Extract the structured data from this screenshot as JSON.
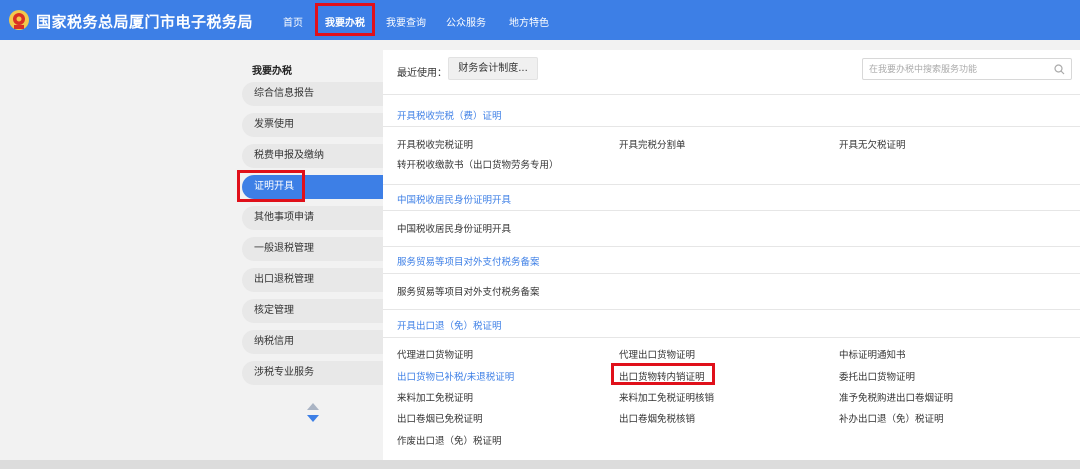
{
  "header": {
    "title": "国家税务总局厦门市电子税务局",
    "nav": [
      "首页",
      "我要办税",
      "我要查询",
      "公众服务",
      "地方特色"
    ],
    "active_nav": "我要办税"
  },
  "sidebar": {
    "title": "我要办税",
    "items": [
      "综合信息报告",
      "发票使用",
      "税费申报及缴纳",
      "证明开具",
      "其他事项申请",
      "一般退税管理",
      "出口退税管理",
      "核定管理",
      "纳税信用",
      "涉税专业服务"
    ],
    "active_item": "证明开具"
  },
  "toolbar": {
    "recent_label": "最近使用：",
    "recent_item": "财务会计制度...",
    "search_placeholder": "在我要办税中搜索服务功能"
  },
  "sections": [
    {
      "title": "开具税收完税（费）证明",
      "items": [
        "开具税收完税证明",
        "开具完税分割单",
        "开具无欠税证明",
        "转开税收缴款书（出口货物劳务专用）"
      ]
    },
    {
      "title": "中国税收居民身份证明开具",
      "items": [
        "中国税收居民身份证明开具"
      ]
    },
    {
      "title": "服务贸易等项目对外支付税务备案",
      "items": [
        "服务贸易等项目对外支付税务备案"
      ]
    },
    {
      "title": "开具出口退（免）税证明",
      "items": [
        "代理进口货物证明",
        "代理出口货物证明",
        "中标证明通知书",
        "出口货物已补税/未退税证明",
        "出口货物转内销证明",
        "委托出口货物证明",
        "来料加工免税证明",
        "来料加工免税证明核销",
        "准予免税购进出口卷烟证明",
        "出口卷烟已免税证明",
        "出口卷烟免税核销",
        "补办出口退（免）税证明",
        "作废出口退（免）税证明"
      ]
    }
  ],
  "colors": {
    "primary": "#3d7fe6",
    "highlight": "#e0101a"
  }
}
